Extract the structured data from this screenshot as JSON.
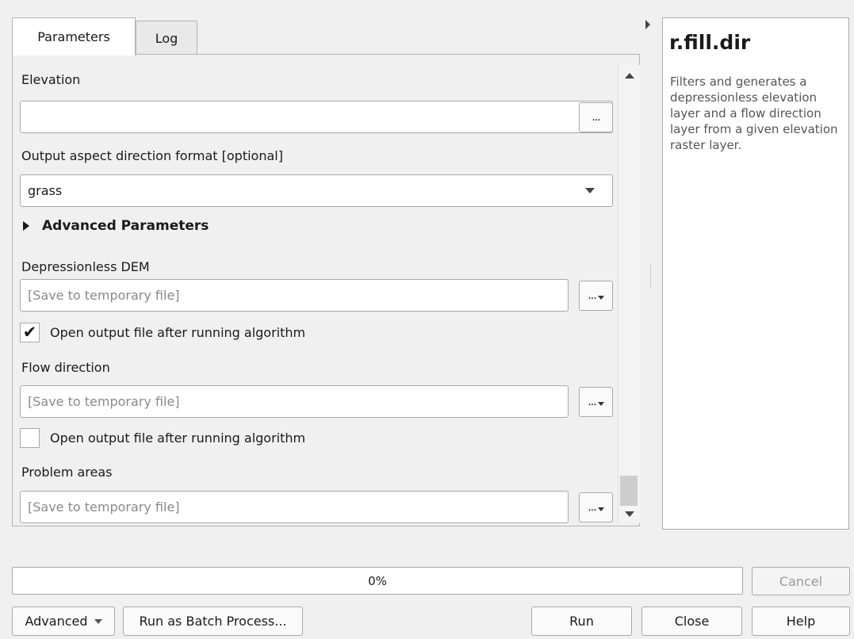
{
  "tabs": [
    {
      "label": "Parameters"
    },
    {
      "label": "Log"
    }
  ],
  "params": {
    "elevation_label": "Elevation",
    "elevation_value": "",
    "aspect_label": "Output aspect direction format [optional]",
    "aspect_value": "grass",
    "advanced_label": "Advanced Parameters",
    "dem_label": "Depressionless DEM",
    "dem_placeholder": "[Save to temporary file]",
    "dem_open_label": "Open output file after running algorithm",
    "dem_open_checked": "✔",
    "flow_label": "Flow direction",
    "flow_placeholder": "[Save to temporary file]",
    "flow_open_label": "Open output file after running algorithm",
    "flow_open_checked": "",
    "problem_label": "Problem areas",
    "problem_placeholder": "[Save to temporary file]",
    "dots": "..."
  },
  "help": {
    "title": "r.fill.dir",
    "description": "Filters and generates a depressionless elevation layer and a flow direction layer from a given elevation raster layer."
  },
  "progress": {
    "text": "0%",
    "value": 0
  },
  "buttons": {
    "cancel": "Cancel",
    "advanced": "Advanced",
    "batch": "Run as Batch Process...",
    "run": "Run",
    "close": "Close",
    "help": "Help"
  },
  "icons": {
    "dropdown": "chevron-down-icon",
    "expand": "triangle-right-icon",
    "check": "checkmark-icon"
  }
}
